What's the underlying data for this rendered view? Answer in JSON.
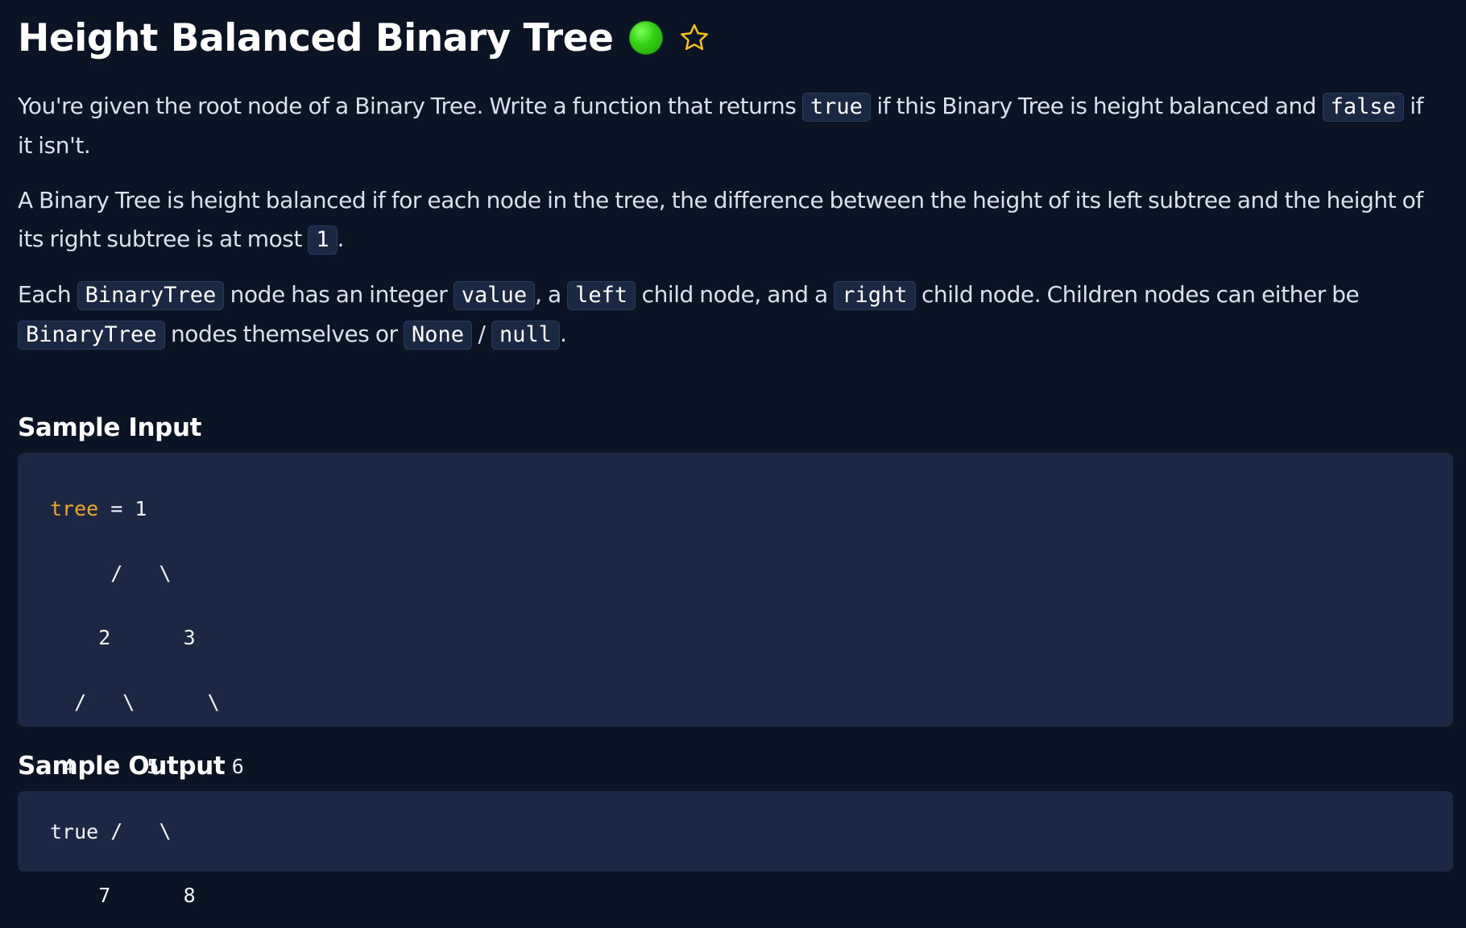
{
  "title": "Height Balanced Binary Tree",
  "status_color": "#35d115",
  "favorite_icon": "star-outline-icon",
  "paragraph1": {
    "t1": "You're given the root node of a Binary Tree. Write a function that returns ",
    "c1": "true",
    "t2": " if this Binary Tree is height balanced and ",
    "c2": "false",
    "t3": " if it isn't."
  },
  "paragraph2": {
    "t1": "A Binary Tree is height balanced if for each node in the tree, the difference between the height of its left subtree and the height of its right subtree is at most ",
    "c1": "1",
    "t2": "."
  },
  "paragraph3": {
    "t1": "Each ",
    "c1": "BinaryTree",
    "t2": " node has an integer ",
    "c2": "value",
    "t3": ", a ",
    "c3": "left",
    "t4": " child node, and a ",
    "c4": "right",
    "t5": " child node. Children nodes can either be ",
    "c5": "BinaryTree",
    "t6": " nodes themselves or ",
    "c6": "None",
    "t7": " / ",
    "c7": "null",
    "t8": "."
  },
  "sample_input": {
    "heading": "Sample Input",
    "keyword": "tree",
    "line1_rest": " = 1",
    "lines": [
      "     /   \\",
      "    2      3",
      "  /   \\      \\",
      " 4      5      6",
      "     /   \\",
      "    7      8"
    ]
  },
  "sample_output": {
    "heading": "Sample Output",
    "value": "true"
  }
}
